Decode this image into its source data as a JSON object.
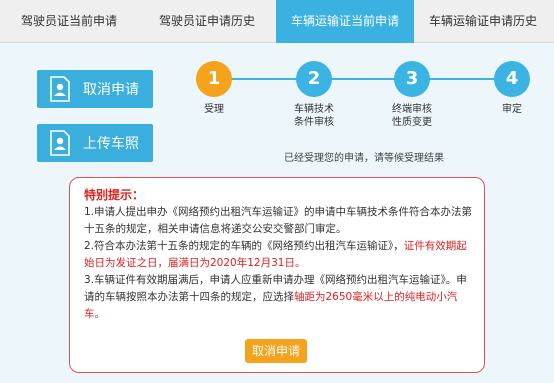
{
  "tabs": [
    {
      "label": "驾驶员证当前申请"
    },
    {
      "label": "驾驶员证申请历史"
    },
    {
      "label": "车辆运输证当前申请"
    },
    {
      "label": "车辆运输证申请历史"
    }
  ],
  "active_tab": 2,
  "colors": {
    "accent": "#3bb1e1",
    "active_step": "#f5a21c",
    "warning": "#e02020"
  },
  "actions": {
    "cancel_label": "取消申请",
    "cancel_icon": "person-card-icon",
    "upload_label": "上传车照",
    "upload_icon": "person-card-icon"
  },
  "steps": [
    {
      "number": "1",
      "label": "受理",
      "state": "active"
    },
    {
      "number": "2",
      "label": "车辆技术",
      "label2": "条件审核",
      "state": "pending"
    },
    {
      "number": "3",
      "label": "终端审核",
      "label2": "性质变更",
      "state": "pending"
    },
    {
      "number": "4",
      "label": "审定",
      "state": "pending"
    }
  ],
  "status_text": "已经受理您的申请，请等候受理结果",
  "notice": {
    "title": "特别提示：",
    "item1": "1.申请人提出申办《网络预约出租汽车运输证》的申请中车辆技术条件符合本办法第十五条的规定，相关申请信息将递交公安交警部门审定。",
    "item2_a": "2.符合本办法第十五条的规定的车辆的《网络预约出租汽车运输证》，",
    "item2_b": "证件有效期起始日为发证之日，届满日为2020年12月31日。",
    "item3_a": "3.车辆证件有效期届满后，申请人应重新申请办理《网络预约出租汽车运输证》。申请的车辆按照本办法第十四条的规定，应选择",
    "item3_b": "轴距为2650毫米以上的纯电动小汽车。",
    "button_label": "取消申请"
  }
}
